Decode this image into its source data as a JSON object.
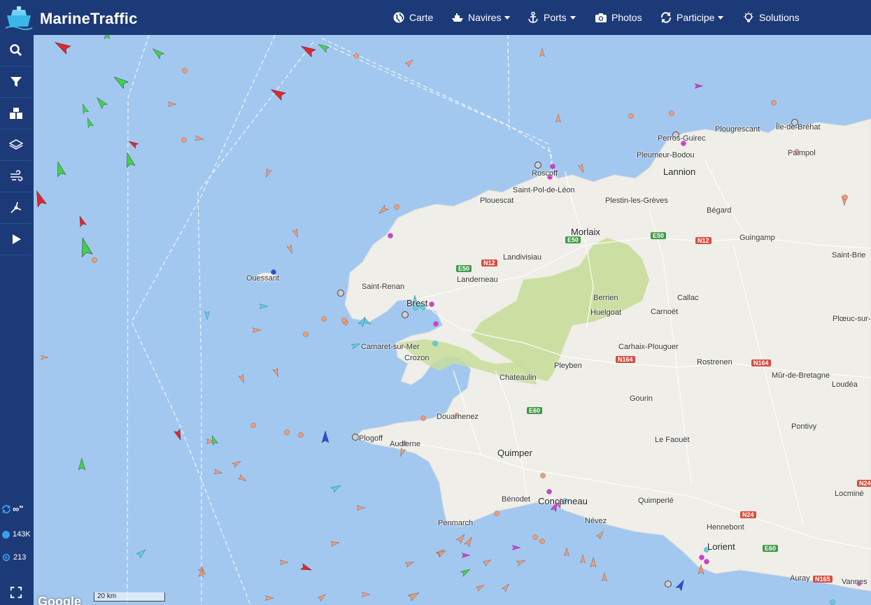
{
  "header": {
    "brand": "MarineTraffic",
    "nav": [
      {
        "label": "Carte",
        "icon": "globe-icon",
        "caret": false
      },
      {
        "label": "Navires",
        "icon": "ship-icon",
        "caret": true
      },
      {
        "label": "Ports",
        "icon": "anchor-icon",
        "caret": true
      },
      {
        "label": "Photos",
        "icon": "camera-icon",
        "caret": false
      },
      {
        "label": "Participe",
        "icon": "sync-icon",
        "caret": true
      },
      {
        "label": "Solutions",
        "icon": "lightbulb-icon",
        "caret": false
      }
    ]
  },
  "sidebar": {
    "tools": [
      "search-icon",
      "filter-icon",
      "fleet-icon",
      "layers-icon",
      "wind-icon",
      "measure-icon",
      "play-icon"
    ],
    "time_label": "∞\"",
    "vessels_count": "143K",
    "stations_count": "213"
  },
  "map": {
    "scale_label": "20 km",
    "attribution": "Google",
    "places": [
      {
        "name": "Perros-Guirec",
        "big": false
      },
      {
        "name": "Plougrescant",
        "big": false
      },
      {
        "name": "Île-de-Bréhat",
        "big": false
      },
      {
        "name": "Pleumeur-Bodou",
        "big": false
      },
      {
        "name": "Paimpol",
        "big": false
      },
      {
        "name": "Roscoff",
        "big": false
      },
      {
        "name": "Lannion",
        "big": true
      },
      {
        "name": "Saint-Pol-de-Léon",
        "big": false
      },
      {
        "name": "Plouescat",
        "big": false
      },
      {
        "name": "Plestin-les-Grèves",
        "big": false
      },
      {
        "name": "Bégard",
        "big": false
      },
      {
        "name": "Morlaix",
        "big": true
      },
      {
        "name": "Guingamp",
        "big": false
      },
      {
        "name": "Saint-Brie",
        "big": false
      },
      {
        "name": "Landivisiau",
        "big": false
      },
      {
        "name": "Ouessant",
        "big": false
      },
      {
        "name": "Landerneau",
        "big": false
      },
      {
        "name": "Saint-Renan",
        "big": false
      },
      {
        "name": "Berrien",
        "big": false
      },
      {
        "name": "Callac",
        "big": false
      },
      {
        "name": "Brest",
        "big": true
      },
      {
        "name": "Huelgoat",
        "big": false
      },
      {
        "name": "Carnoët",
        "big": false
      },
      {
        "name": "Plœuc-sur-",
        "big": false
      },
      {
        "name": "Camaret-sur-Mer",
        "big": false
      },
      {
        "name": "Carhaix-Plouguer",
        "big": false
      },
      {
        "name": "Crozon",
        "big": false
      },
      {
        "name": "Pleyben",
        "big": false
      },
      {
        "name": "Rostrenen",
        "big": false
      },
      {
        "name": "Mûr-de-Bretagne",
        "big": false
      },
      {
        "name": "Chateaulin",
        "big": false
      },
      {
        "name": "Loudéa",
        "big": false
      },
      {
        "name": "Gourin",
        "big": false
      },
      {
        "name": "Douarnenez",
        "big": false
      },
      {
        "name": "Plogoff",
        "big": false
      },
      {
        "name": "Audierne",
        "big": false
      },
      {
        "name": "Pontivy",
        "big": false
      },
      {
        "name": "Le Faouët",
        "big": false
      },
      {
        "name": "Quimper",
        "big": true
      },
      {
        "name": "Locminé",
        "big": false
      },
      {
        "name": "Bénodet",
        "big": false
      },
      {
        "name": "Concarneau",
        "big": true
      },
      {
        "name": "Quimperlé",
        "big": false
      },
      {
        "name": "Névez",
        "big": false
      },
      {
        "name": "Penmarch",
        "big": false
      },
      {
        "name": "Hennebont",
        "big": false
      },
      {
        "name": "Lorient",
        "big": true
      },
      {
        "name": "Auray",
        "big": false
      },
      {
        "name": "Vannes",
        "big": false
      }
    ],
    "roads": [
      {
        "label": "E50",
        "kind": "e"
      },
      {
        "label": "E50",
        "kind": "e"
      },
      {
        "label": "N12",
        "kind": "n"
      },
      {
        "label": "E50",
        "kind": "e"
      },
      {
        "label": "N12",
        "kind": "n"
      },
      {
        "label": "N164",
        "kind": "n"
      },
      {
        "label": "N164",
        "kind": "n"
      },
      {
        "label": "E60",
        "kind": "e"
      },
      {
        "label": "N24",
        "kind": "n"
      },
      {
        "label": "N24",
        "kind": "n"
      },
      {
        "label": "E60",
        "kind": "e"
      },
      {
        "label": "N165",
        "kind": "n"
      }
    ]
  },
  "colors": {
    "header": "#1d3a78",
    "sea": "#a3c8f0",
    "land": "#efeee8",
    "forest": "#c8dd9a",
    "cargo": "#3fd34d",
    "tanker": "#e5252b",
    "fishing": "#f59a71",
    "passenger": "#2b4be0",
    "tug": "#4fd6e6",
    "pleasure": "#d93ad9"
  }
}
